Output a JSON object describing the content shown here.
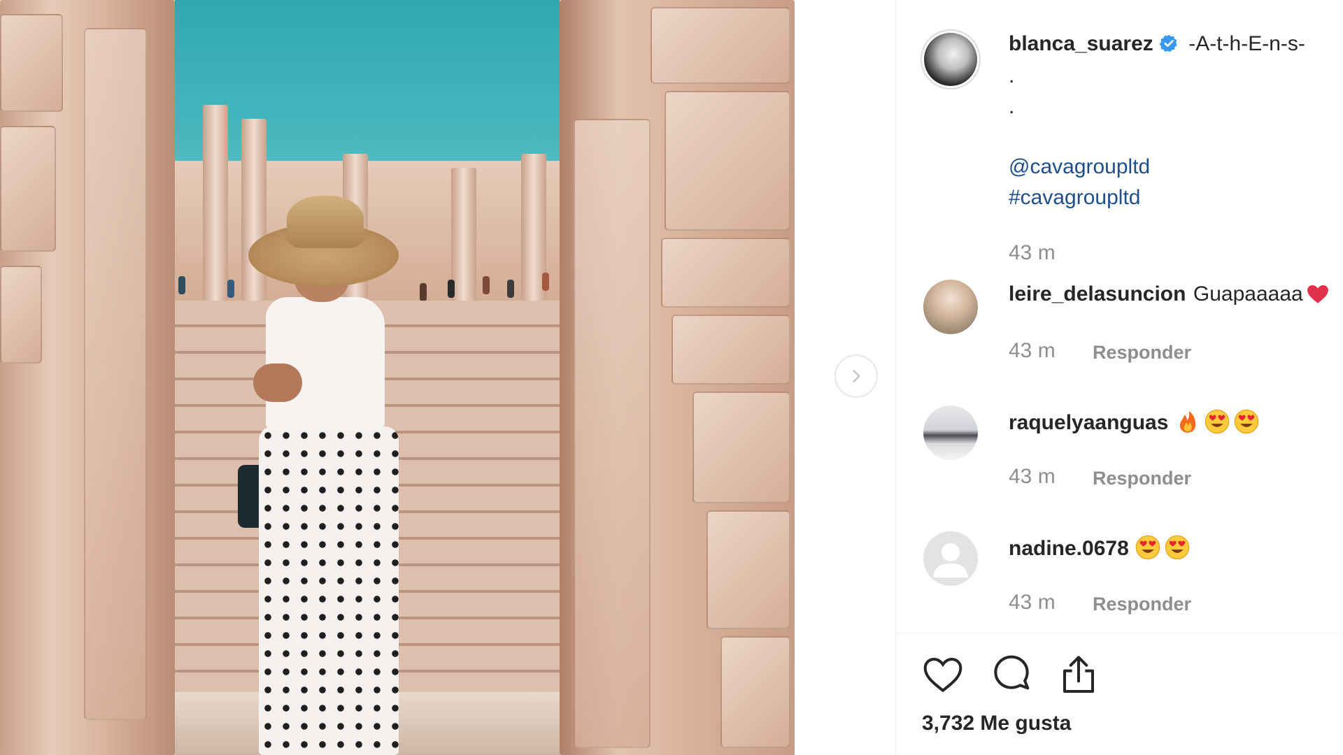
{
  "post": {
    "author": {
      "username": "blanca_suarez",
      "verified_icon": "verified-badge-icon",
      "caption_title": "-A-t-h-E-n-s-",
      "caption_dot_1": ".",
      "caption_dot_2": ".",
      "mention": "@cavagroupltd",
      "hashtag": "#cavagroupltd",
      "time": "43 m"
    },
    "comments": [
      {
        "username": "leire_delasuncion",
        "text": "Guapaaaaa",
        "emojis": [
          "heart"
        ],
        "time": "43 m",
        "reply_label": "Responder"
      },
      {
        "username": "raquelyaanguas",
        "text": "",
        "emojis": [
          "fire",
          "heart-eyes",
          "heart-eyes"
        ],
        "time": "43 m",
        "reply_label": "Responder"
      },
      {
        "username": "nadine.0678",
        "text": "",
        "emojis": [
          "heart-eyes",
          "heart-eyes"
        ],
        "time": "43 m",
        "reply_label": "Responder"
      }
    ],
    "actions": {
      "like_icon": "heart-icon",
      "comment_icon": "comment-icon",
      "share_icon": "share-icon"
    },
    "likes_text": "3,732 Me gusta"
  },
  "navigation": {
    "next_icon": "chevron-right-icon"
  },
  "colors": {
    "text": "#262626",
    "muted": "#8e8e8e",
    "link": "#1f4f8a",
    "verified": "#3897f0",
    "divider": "#efefef"
  }
}
